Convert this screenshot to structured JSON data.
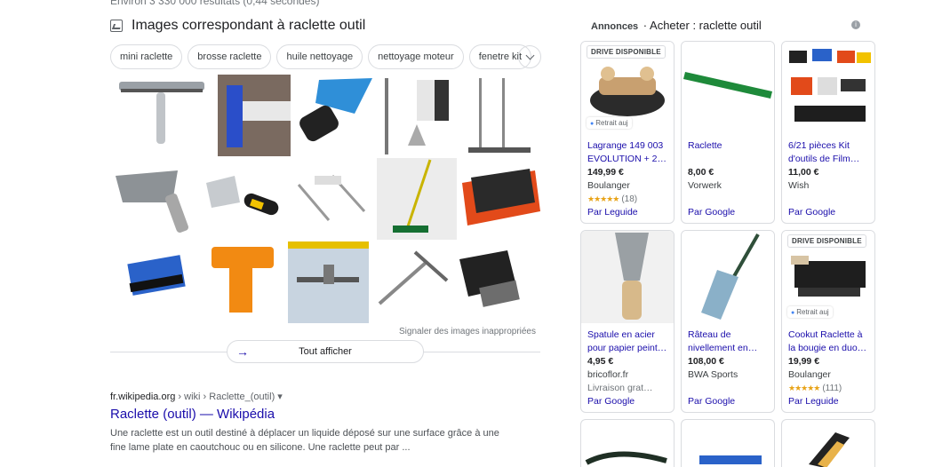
{
  "result_stats": "Environ 3 330 000 résultats (0,44 secondes)",
  "images": {
    "title": "Images correspondant à raclette outil",
    "chips": [
      "mini raclette",
      "brosse raclette",
      "huile nettoyage",
      "nettoyage moteur",
      "fenetre kit"
    ],
    "report": "Signaler des images inappropriées",
    "show_all": "Tout afficher"
  },
  "wiki": {
    "domain": "fr.wikipedia.org",
    "path": " › wiki › Raclette_(outil)",
    "dropdown": "▾",
    "title": "Raclette (outil) — Wikipédia",
    "snippet": "Une raclette est un outil destiné à déplacer un liquide déposé sur une surface grâce à une fine lame plate en caoutchouc ou en silicone. Une raclette peut par ..."
  },
  "ads": {
    "label": "Annonces",
    "title": "Acheter : raclette outil",
    "info": "i",
    "products": [
      {
        "badge": "DRIVE DISPONIBLE",
        "pickup": "Retrait auj",
        "title": "Lagrange 149 003 EVOLUTION + 2…",
        "price": "149,99 €",
        "shop": "Boulanger",
        "stars": "★★★★★",
        "reviews": "(18)",
        "by": "Par Leguide"
      },
      {
        "badge": "",
        "pickup": "",
        "title": "Raclette",
        "price": "8,00 €",
        "shop": "Vorwerk",
        "stars": "",
        "reviews": "",
        "by": "Par Google"
      },
      {
        "badge": "",
        "pickup": "",
        "title": "6/21 pièces Kit d'outils de Film…",
        "price": "11,00 €",
        "shop": "Wish",
        "stars": "",
        "reviews": "",
        "by": "Par Google"
      },
      {
        "badge": "",
        "pickup": "",
        "title": "Spatule en acier pour papier peint…",
        "price": "4,95 €",
        "shop": "bricoflor.fr",
        "extra": "Livraison grat…",
        "stars": "",
        "reviews": "",
        "by": "Par Google"
      },
      {
        "badge": "",
        "pickup": "",
        "title": "Râteau de nivellement en…",
        "price": "108,00 €",
        "shop": "BWA Sports",
        "stars": "",
        "reviews": "",
        "by": "Par Google"
      },
      {
        "badge": "DRIVE DISPONIBLE",
        "pickup": "Retrait auj",
        "title": "Cookut Raclette à la bougie en duo…",
        "price": "19,99 €",
        "shop": "Boulanger",
        "stars": "★★★★★",
        "reviews": "(111)",
        "by": "Par Leguide"
      }
    ]
  }
}
